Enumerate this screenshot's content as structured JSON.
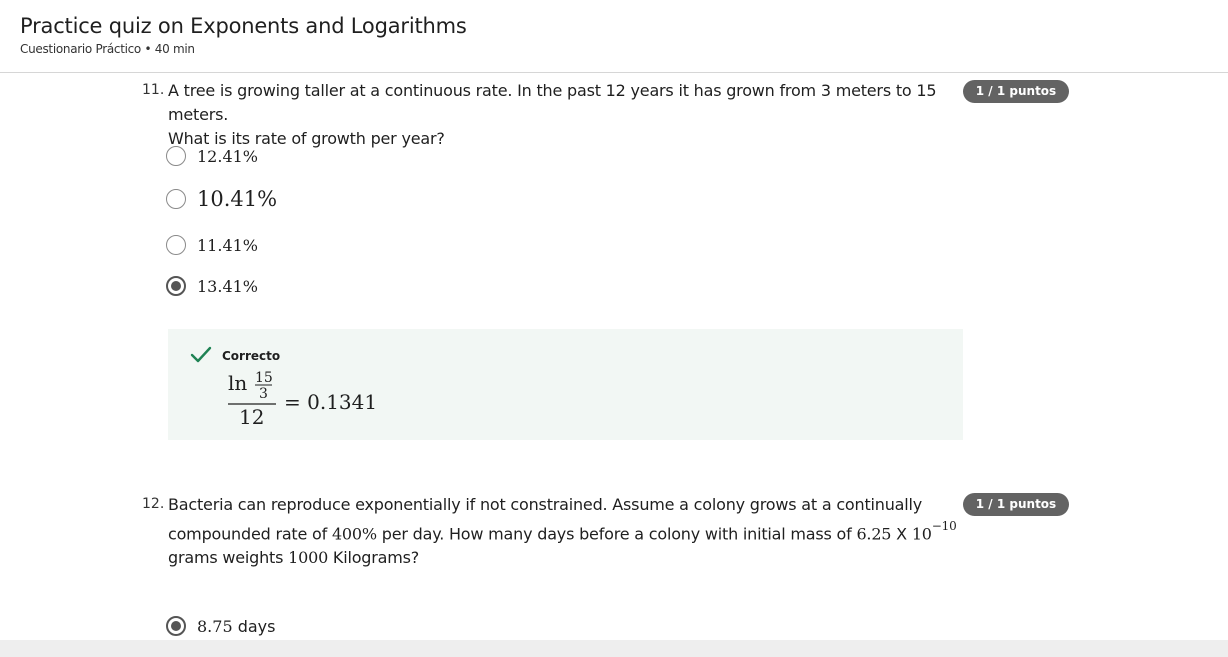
{
  "header": {
    "title": "Practice quiz on Exponents and Logarithms",
    "subtitle": "Cuestionario Práctico • 40 min"
  },
  "questions": [
    {
      "number": "11.",
      "text_line1": "A tree is growing taller at a continuous rate. In the past 12 years it has grown from 3 meters to 15 meters.",
      "text_line2": "What is its rate of growth per year?",
      "badge": "1 / 1 puntos",
      "options": [
        {
          "label": "12.41%",
          "selected": false
        },
        {
          "label": "10.41%",
          "selected": false
        },
        {
          "label": "11.41%",
          "selected": false
        },
        {
          "label": "13.41%",
          "selected": true
        }
      ],
      "feedback": {
        "status": "Correcto",
        "formula": {
          "ln": "ln",
          "numerator_top": "15",
          "numerator_bottom": "3",
          "denominator": "12",
          "result": "= 0.1341"
        }
      }
    },
    {
      "number": "12.",
      "text_line1": "Bacteria can reproduce exponentially if not constrained. Assume a colony grows at a continually",
      "text_line2_pre": "compounded rate of ",
      "rate": "400%",
      "text_line2_mid": " per day. How many days before a colony with initial mass of ",
      "mass_coef": "6.25",
      "mass_x": " X ",
      "mass_base": "10",
      "mass_exp": "−10",
      "text_line3_pre": "grams weights ",
      "weight": "1000",
      "text_line3_post": " Kilograms?",
      "badge": "1 / 1 puntos",
      "options": [
        {
          "value": "8.75",
          "unit": " days",
          "selected": true
        }
      ]
    }
  ],
  "colors": {
    "badge_bg": "#636363",
    "feedback_bg": "#f2f7f4",
    "correct_check": "#1f8354",
    "radio_selected": "#555555"
  },
  "icons": {
    "correct": "check-icon",
    "radio": "radio-icon"
  }
}
